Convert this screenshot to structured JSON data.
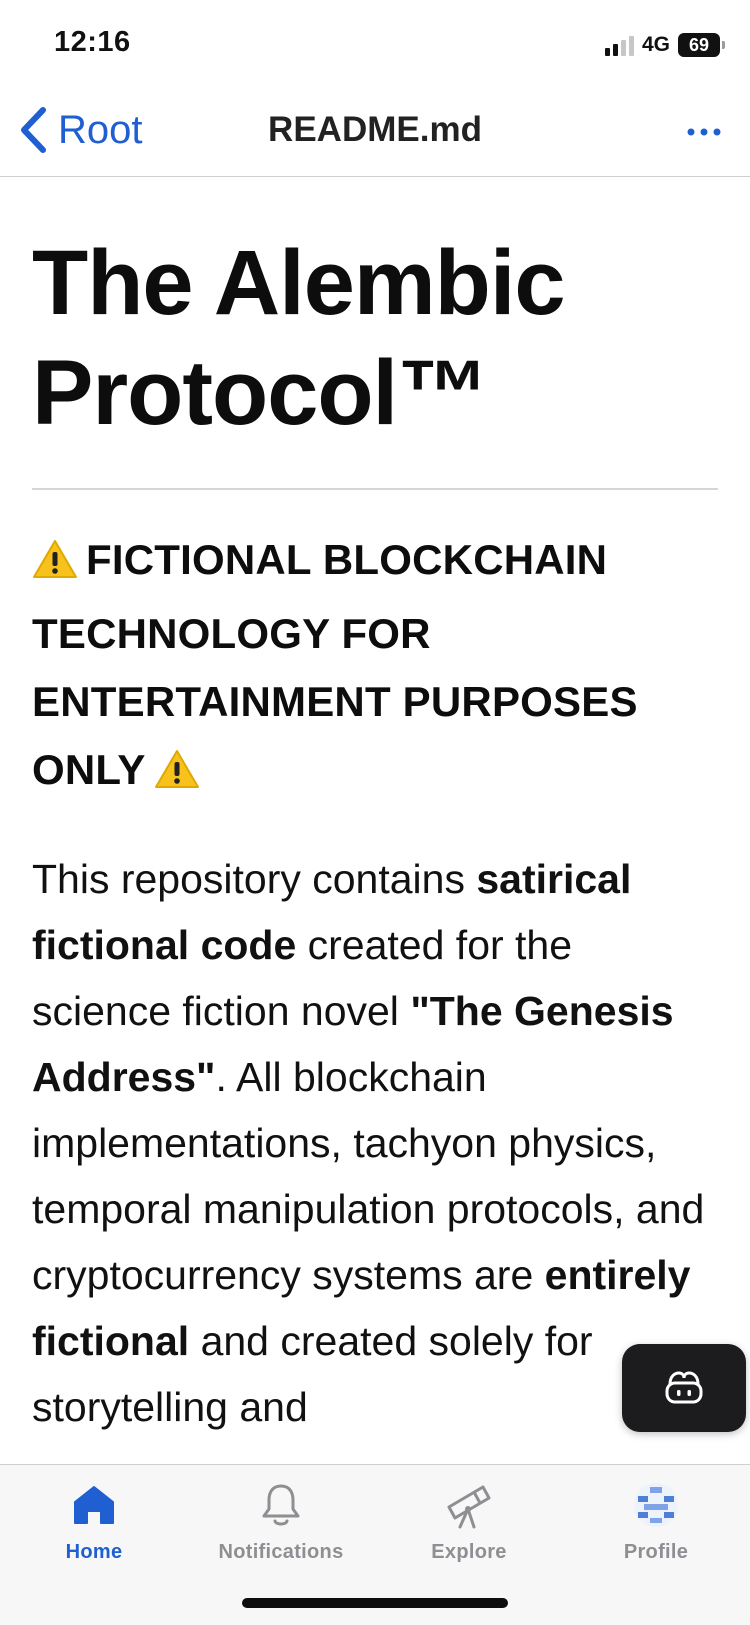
{
  "status_bar": {
    "time": "12:16",
    "network": "4G",
    "battery": "69"
  },
  "nav": {
    "back_label": "Root",
    "title": "README.md",
    "more_icon": "ellipsis-icon"
  },
  "document": {
    "title": "The Alembic Protocol™",
    "warning_heading": "FICTIONAL BLOCKCHAIN TECHNOLOGY FOR ENTERTAINMENT PURPOSES ONLY",
    "warning_icon": "warning-emoji",
    "paragraph": {
      "t1": "This repository contains ",
      "b1": "satirical fictional code",
      "t2": " created for the science fiction novel ",
      "b2": "\"The Genesis Address\"",
      "t3": ". All blockchain implementations, tachyon physics, temporal manipulation protocols, and cryptocurrency systems are ",
      "b3": "entirely fictional",
      "t4": " and created solely for storytelling and"
    }
  },
  "fab": {
    "icon": "copilot-icon"
  },
  "tabs": [
    {
      "label": "Home",
      "icon": "house-icon",
      "active": true
    },
    {
      "label": "Notifications",
      "icon": "bell-icon",
      "active": false
    },
    {
      "label": "Explore",
      "icon": "telescope-icon",
      "active": false
    },
    {
      "label": "Profile",
      "icon": "avatar-icon",
      "active": false
    }
  ],
  "colors": {
    "accent": "#1f5fd1",
    "inactive_tab": "#8e8e93",
    "fab_background": "#1c1c1e"
  }
}
